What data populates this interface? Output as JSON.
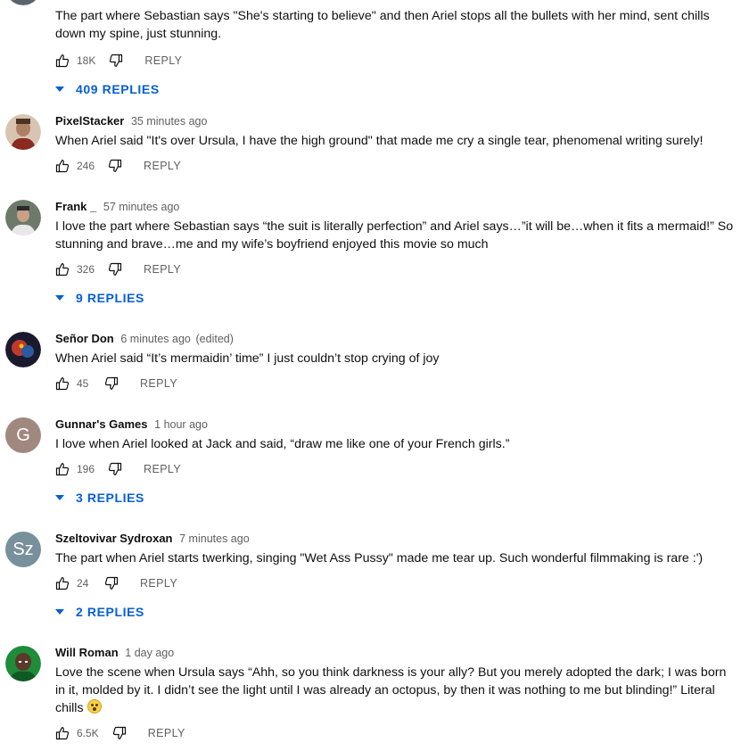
{
  "labels": {
    "reply": "REPLY"
  },
  "colors": {
    "link_blue": "#065fd4",
    "meta_gray": "#606060",
    "text_dark": "#0f0f0f"
  },
  "icons": {
    "like": "thumbs-up-icon",
    "dislike": "thumbs-down-icon",
    "expand": "caret-down-icon",
    "emoji": "flushed-face-emoji"
  },
  "comments": [
    {
      "author": "",
      "time": "",
      "text": "The part where Sebastian says \"She's starting to believe\" and then Ariel stops all the bullets with her mind, sent chills down my spine, just stunning.",
      "likes": "18K",
      "replies": "409 REPLIES"
    },
    {
      "author": "PixelStacker",
      "time": "35 minutes ago",
      "text": "When Ariel said \"It's over Ursula, I have the high ground\" that made me cry a single tear, phenomenal writing surely!",
      "likes": "246"
    },
    {
      "author": "Frank _",
      "time": "57 minutes ago",
      "text": "I love the part where Sebastian says “the suit is literally perfection” and Ariel says…”it will be…when it fits a mermaid!” So stunning and brave…me and my wife’s boyfriend enjoyed this movie so much",
      "likes": "326",
      "replies": "9 REPLIES"
    },
    {
      "author": "Señor Don",
      "time": "6 minutes ago",
      "edited": "(edited)",
      "text": "When Ariel said “It’s mermaidin’ time” I just couldn’t stop crying of joy",
      "likes": "45"
    },
    {
      "author": "Gunnar's Games",
      "time": "1 hour ago",
      "avatar_letter": "G",
      "avatar_color": "#a1887f",
      "text": "I love when Ariel looked at Jack and said, “draw me like one of your French girls.”",
      "likes": "196",
      "replies": "3 REPLIES"
    },
    {
      "author": "Szeltovivar Sydroxan",
      "time": "7 minutes ago",
      "avatar_letter": "Sz",
      "avatar_color": "#78909c",
      "text": "The part when Ariel starts twerking, singing \"Wet Ass Pussy\" made me tear up. Such wonderful filmmaking is rare :')",
      "likes": "24",
      "replies": "2 REPLIES"
    },
    {
      "author": "Will Roman",
      "time": "1 day ago",
      "text": "Love the scene when Ursula says “Ahh, so you think darkness is your ally? But you merely adopted the dark; I was born in it, molded by it. I didn’t see the light until I was already an octopus, by then it was nothing to me but blinding!” Literal chills",
      "likes": "6.5K"
    }
  ]
}
